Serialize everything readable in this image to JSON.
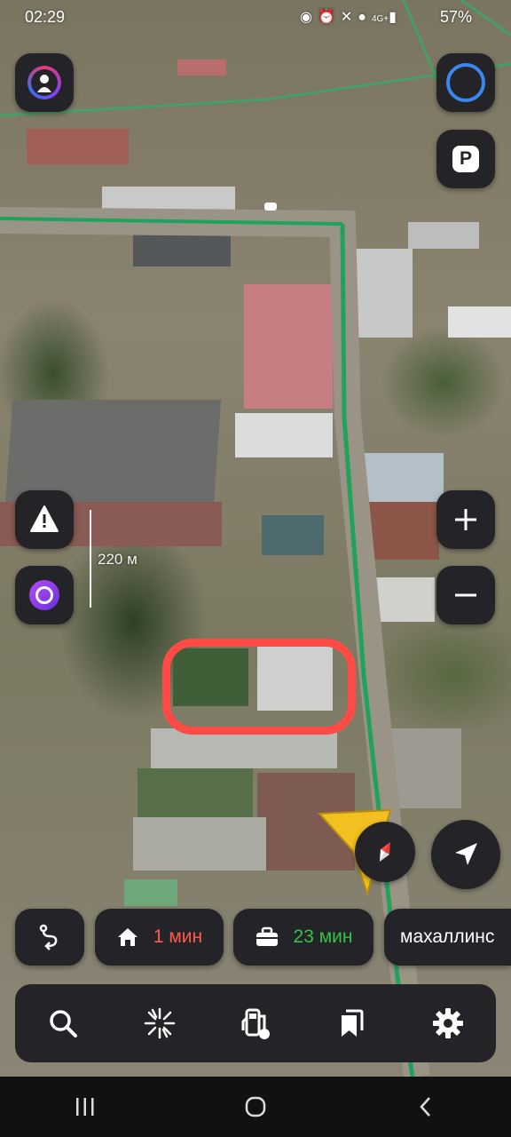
{
  "status_bar": {
    "time": "02:29",
    "icons": [
      "camera-icon",
      "alarm-icon",
      "mute-icon",
      "location-icon",
      "4g-icon",
      "signal-icon"
    ],
    "battery": "57%"
  },
  "map": {
    "scale_label": "220 м",
    "route_color": "#1fa35a",
    "highlight_color": "#ff4a45"
  },
  "chips": {
    "home": {
      "time": "1 мин",
      "color": "#ff5a4f"
    },
    "work": {
      "time": "23 мин",
      "color": "#35c24a"
    },
    "place": {
      "label": "махаллинс"
    }
  },
  "toolbar": {
    "items": [
      "search-icon",
      "discover-icon",
      "gas-station-icon",
      "bookmarks-icon",
      "settings-icon"
    ]
  },
  "nav": {
    "items": [
      "recent-apps-icon",
      "home-icon",
      "back-icon"
    ]
  }
}
